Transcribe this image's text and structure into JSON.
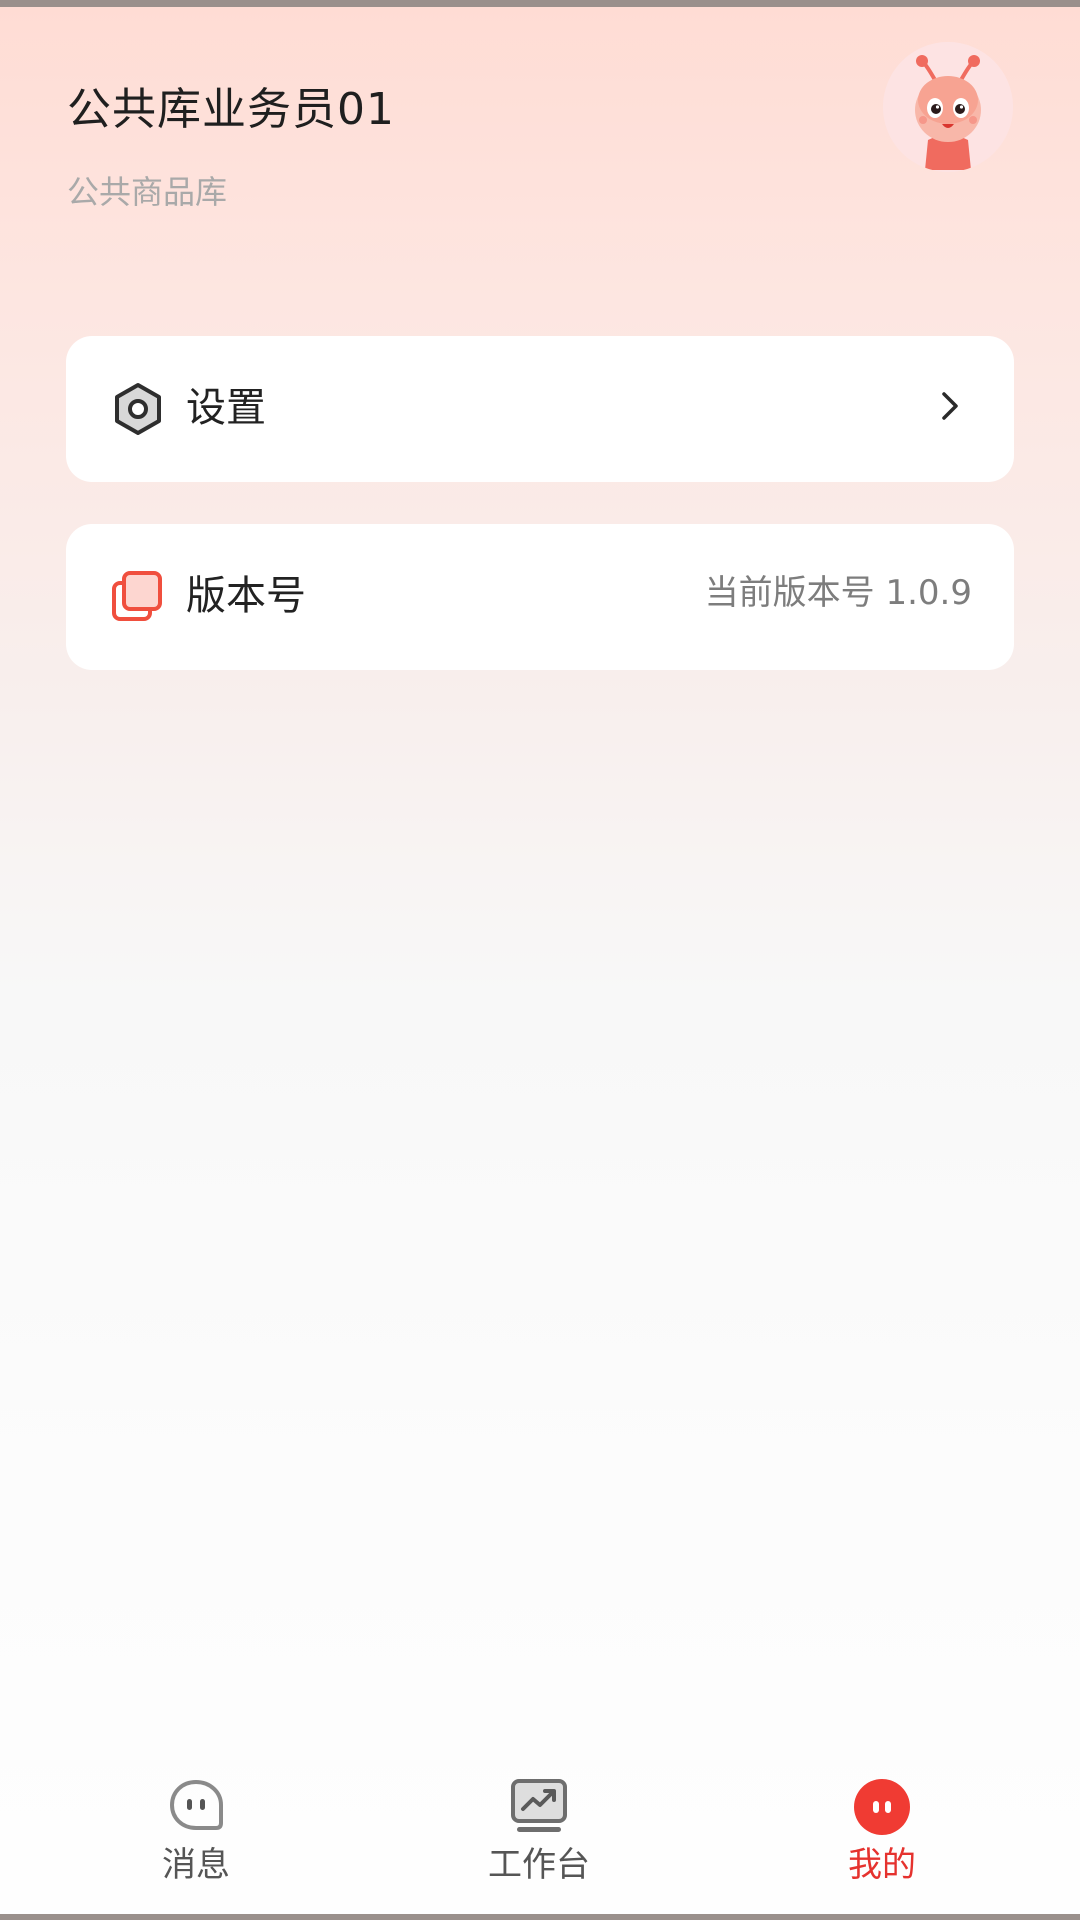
{
  "header": {
    "user_name": "公共库业务员01",
    "organization": "公共商品库",
    "avatar_icon": "ant-mascot-avatar"
  },
  "menu": {
    "settings": {
      "label": "设置",
      "icon": "gear-icon"
    },
    "version": {
      "label": "版本号",
      "value": "当前版本号 1.0.9",
      "icon": "layers-icon"
    }
  },
  "tabbar": {
    "items": [
      {
        "label": "消息",
        "icon": "message-icon",
        "active": false
      },
      {
        "label": "工作台",
        "icon": "workbench-icon",
        "active": false
      },
      {
        "label": "我的",
        "icon": "mine-icon",
        "active": true
      }
    ]
  },
  "colors": {
    "accent": "#e5322e",
    "header_gradient_top": "#ffdcd4",
    "text_primary": "#1f1f1f",
    "text_secondary": "#a9a9a9"
  }
}
